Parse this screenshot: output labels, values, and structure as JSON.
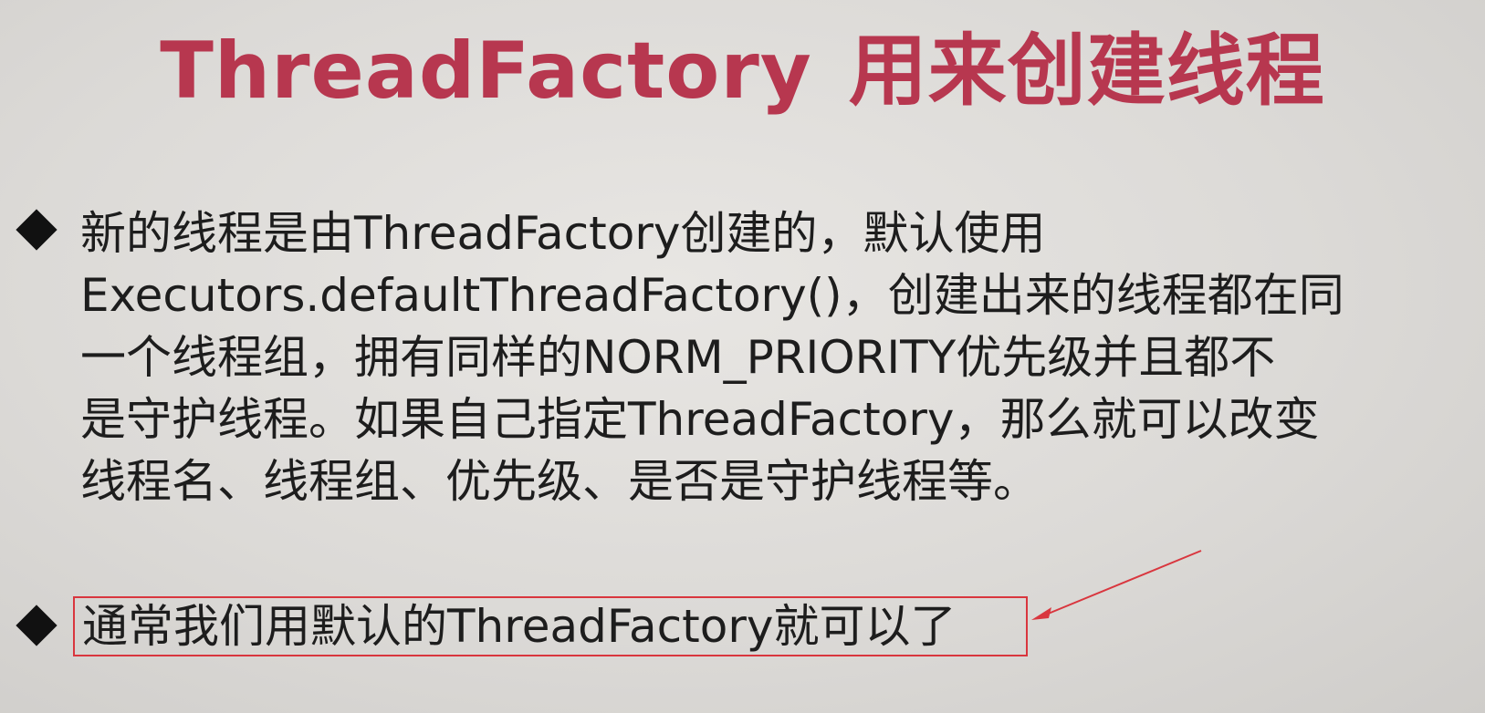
{
  "slide": {
    "title_en": "ThreadFactory",
    "title_cn": "用来创建线程",
    "bullet1_lines": [
      "新的线程是由ThreadFactory创建的，默认使用",
      "Executors.defaultThreadFactory()，创建出来的线程都在同",
      "一个线程组，拥有同样的NORM_PRIORITY优先级并且都不",
      "是守护线程。如果自己指定ThreadFactory，那么就可以改变",
      "线程名、线程组、优先级、是否是守护线程等。"
    ],
    "bullet2_text": "通常我们用默认的ThreadFactory就可以了",
    "colors": {
      "title": "#b7374f",
      "text": "#1d1d1d",
      "annotation": "#d9363e"
    },
    "icons": {
      "bullet": "diamond-bullet-icon",
      "annotation": "red-arrow-icon"
    }
  }
}
